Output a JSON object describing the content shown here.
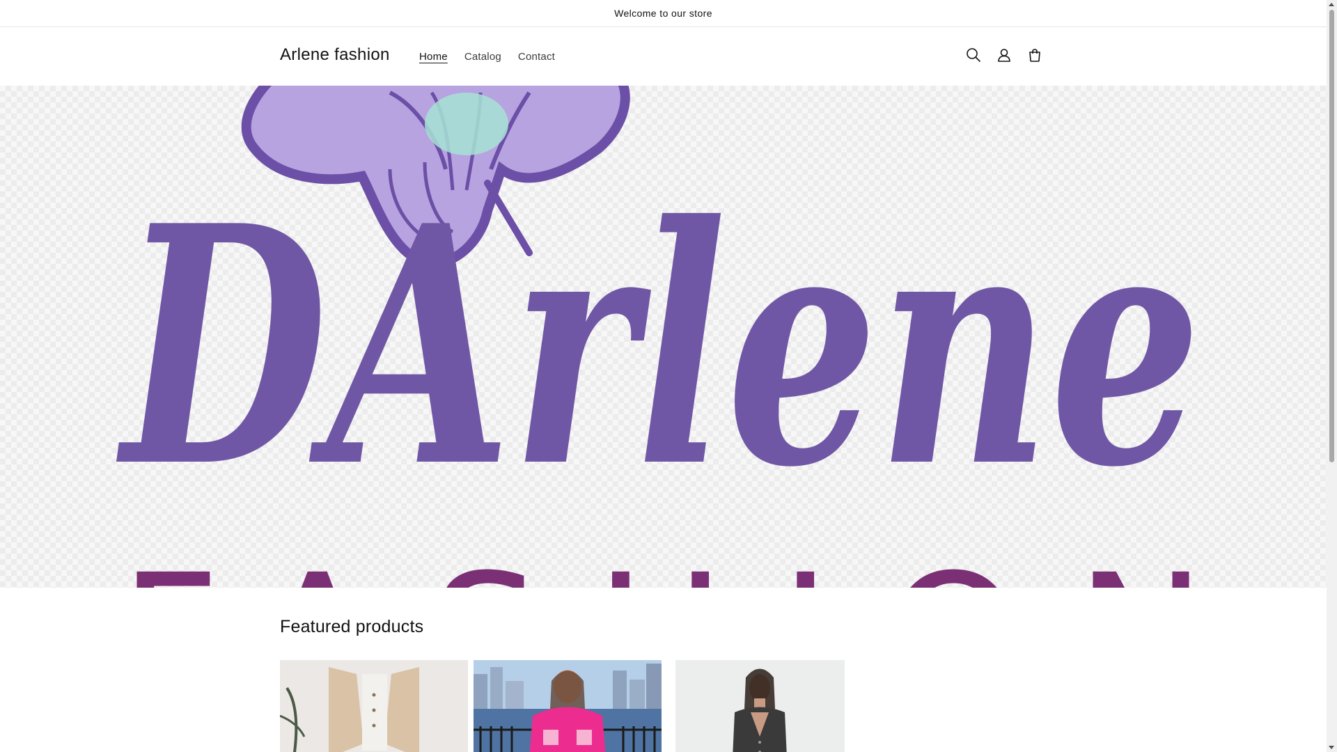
{
  "announcement": {
    "text": "Welcome to our store"
  },
  "header": {
    "brand": "Arlene fashion",
    "nav": [
      {
        "label": "Home",
        "active": true
      },
      {
        "label": "Catalog",
        "active": false
      },
      {
        "label": "Contact",
        "active": false
      }
    ],
    "icons": [
      "search-icon",
      "account-icon",
      "cart-icon"
    ]
  },
  "hero": {
    "logo_script_text": "DArlene",
    "logo_caps_text": "FASHION",
    "colors": {
      "script": "#7057a5",
      "caps": "#7b2f74",
      "butterfly_wing": "#b7a3e0",
      "butterfly_outline": "#6c4fa6",
      "butterfly_accent": "#a7e3d4"
    }
  },
  "featured": {
    "title": "Featured products",
    "products": [
      {
        "image": "product-image-beige-vest-set"
      },
      {
        "image": "product-image-pink-jumpsuit"
      },
      {
        "image": "product-image-black-vest"
      }
    ]
  },
  "colors": {
    "text": "#121212",
    "muted_text": "#3b3b3b",
    "border": "#e6e6e6"
  }
}
